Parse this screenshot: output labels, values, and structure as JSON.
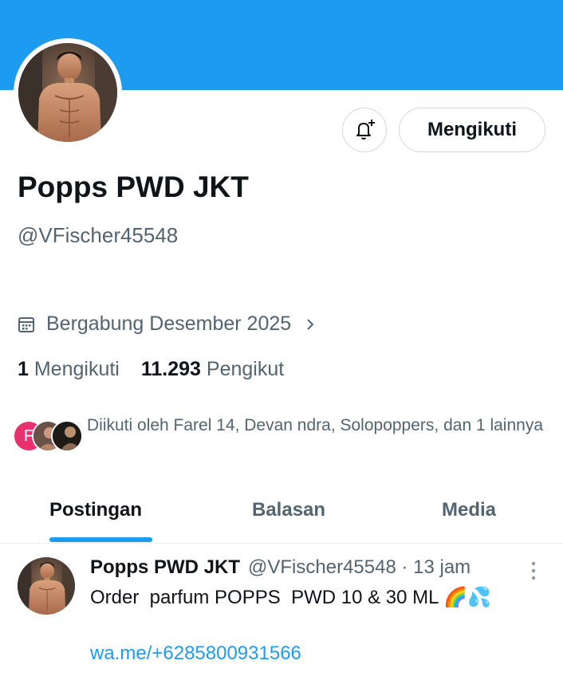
{
  "profile": {
    "display_name": "Popps PWD JKT",
    "handle": "@VFischer45548",
    "joined": "Bergabung Desember 2025",
    "following_count": "1",
    "following_label": "Mengikuti",
    "followers_count": "11.293",
    "followers_label": "Pengikut",
    "follow_button": "Mengikuti",
    "followed_by_initial": "F",
    "followed_by_text": "Diikuti oleh Farel 14, Devan ndra, Solopoppers, dan 1 lainnya"
  },
  "tabs": [
    "Postingan",
    "Balasan",
    "Media"
  ],
  "post": {
    "author": "Popps PWD JKT",
    "meta": "@VFischer45548 · 13 jam",
    "text": "Order  parfum POPPS  PWD 10 & 30 ML 🌈💦",
    "link": "wa.me/+6285800931566"
  },
  "colors": {
    "banner": "#1d9bf0",
    "accent": "#1d9bf0",
    "secondary_text": "#536471",
    "avatar_badge": "#e8326f"
  },
  "icons": [
    "bell-plus-icon",
    "calendar-icon",
    "chevron-right-icon",
    "more-vertical-icon"
  ]
}
